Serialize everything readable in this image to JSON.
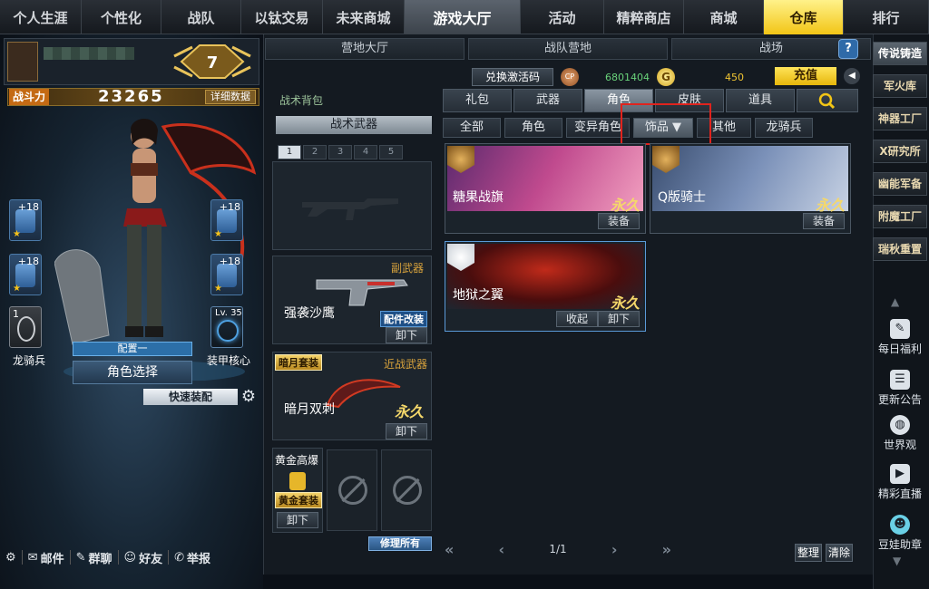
{
  "topnav": [
    "个人生涯",
    "个性化",
    "战队",
    "以钛交易",
    "未来商城",
    "游戏大厅",
    "活动",
    "精粹商店",
    "商城",
    "仓库",
    "排行"
  ],
  "profile": {
    "rank_level": "7",
    "power_label": "战斗力",
    "power_value": "23265",
    "detail_label": "详细数据"
  },
  "left_slots": {
    "lt1": "+18",
    "rt1": "+18",
    "lt2": "+18",
    "rt2": "+18",
    "char_slot_num": "1",
    "char_name": "龙骑兵",
    "core_level": "Lv. 35",
    "core_name": "装甲核心",
    "config_label": "配置一",
    "role_select": "角色选择",
    "quick_equip": "快速装配"
  },
  "bottombar": {
    "mail": "邮件",
    "chat": "群聊",
    "friends": "好友",
    "report": "举报"
  },
  "subtabs": [
    "营地大厅",
    "战队营地",
    "战场"
  ],
  "help": "?",
  "backpack": {
    "title": "战术背包",
    "tactical": "战术武器",
    "pages": [
      "1",
      "2",
      "3",
      "4",
      "5"
    ],
    "secondary": {
      "type": "副武器",
      "name": "强袭沙鹰",
      "badge": "配件改装",
      "action": "卸下"
    },
    "melee": {
      "type": "近战武器",
      "name": "暗月双刺",
      "badge": "暗月套装",
      "perm": "永久",
      "action": "卸下"
    },
    "grenade": {
      "name": "黄金高爆",
      "badge": "黄金套装",
      "action": "卸下"
    },
    "repair": "修理所有"
  },
  "currency": {
    "redeem": "兑换激活码",
    "cp_icon": "CP",
    "cp_value": "6801404",
    "g_icon": "G",
    "g_value": "450",
    "recharge": "充值"
  },
  "category_tabs": [
    "礼包",
    "武器",
    "角色",
    "皮肤",
    "道具"
  ],
  "category_active": "角色",
  "filter_tabs": [
    "全部",
    "角色",
    "变异角色",
    "饰品 ▼",
    "其他",
    "龙骑兵"
  ],
  "filter_active": "饰品 ▼",
  "items": [
    {
      "name": "糖果战旗",
      "perm": "永久",
      "actions": [
        "装备"
      ]
    },
    {
      "name": "Q版骑士",
      "perm": "永久",
      "actions": [
        "装备"
      ]
    },
    {
      "name": "地狱之翼",
      "perm": "永久",
      "actions": [
        "收起",
        "卸下"
      ]
    }
  ],
  "pager": {
    "first": "«",
    "prev": "‹",
    "page": "1/1",
    "next": "›",
    "last": "»"
  },
  "sort_buttons": [
    "整理",
    "清除"
  ],
  "rightbar": {
    "items": [
      "传说铸造",
      "军火库",
      "神器工厂",
      "X研究所",
      "幽能军备",
      "附魔工厂",
      "瑞秋重置"
    ],
    "icons": [
      "每日福利",
      "更新公告",
      "世界观",
      "精彩直播",
      "豆娃助章"
    ]
  },
  "colors": {
    "accent": "#f2c516",
    "highlight": "#e0231d",
    "panel": "#141a21"
  }
}
